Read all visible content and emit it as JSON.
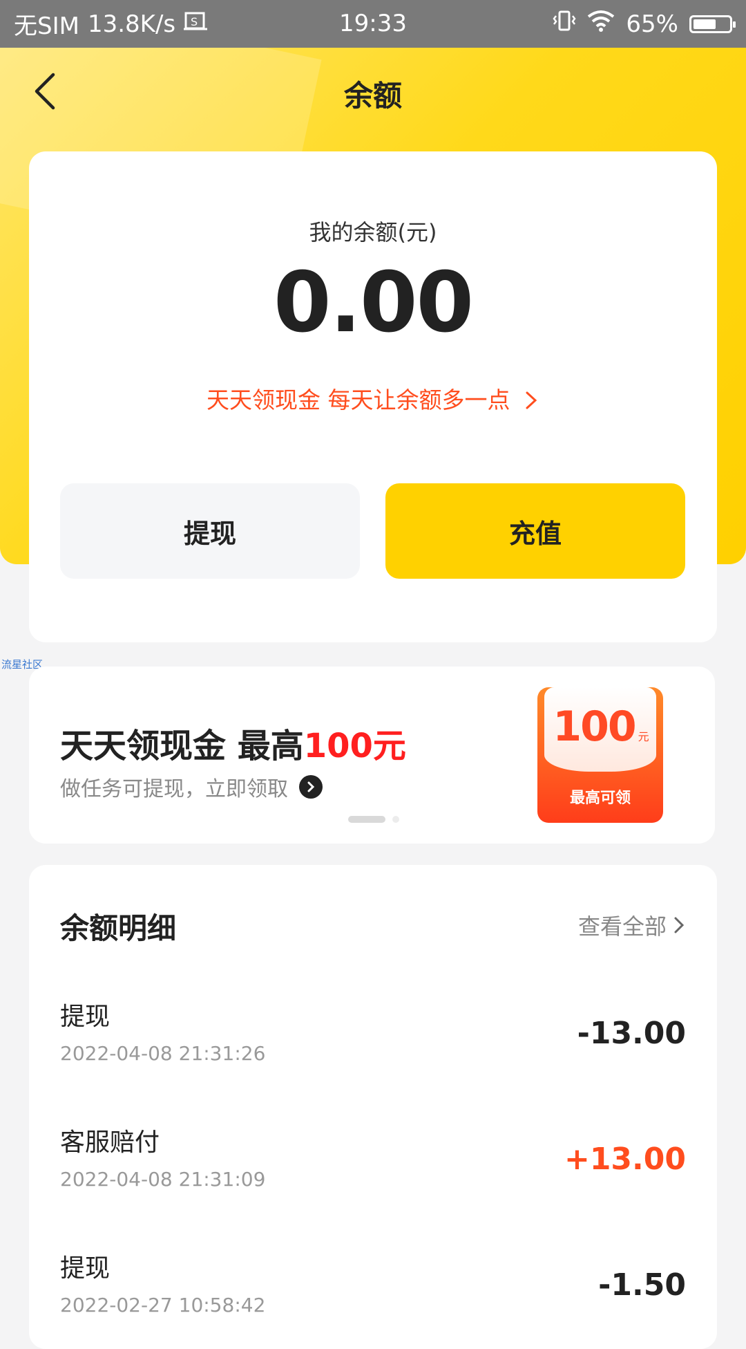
{
  "status_bar": {
    "sim": "无SIM",
    "speed": "13.8K/s",
    "time": "19:33",
    "battery": "65%",
    "battery_level": 0.65
  },
  "header": {
    "title": "余额"
  },
  "balance": {
    "label": "我的余额(元)",
    "value": "0.00",
    "promo_text": "天天领现金 每天让余额多一点",
    "withdraw_label": "提现",
    "recharge_label": "充值"
  },
  "watermark": "流星社区",
  "banner": {
    "title_prefix": "天天领现金 最高",
    "title_highlight": "100元",
    "subtitle": "做任务可提现，立即领取",
    "packet_amount": "100",
    "packet_unit": "元",
    "packet_label": "最高可领"
  },
  "details": {
    "title": "余额明细",
    "view_all": "查看全部",
    "transactions": [
      {
        "name": "提现",
        "time": "2022-04-08 21:31:26",
        "amount": "-13.00"
      },
      {
        "name": "客服赔付",
        "time": "2022-04-08 21:31:09",
        "amount": "+13.00"
      },
      {
        "name": "提现",
        "time": "2022-02-27 10:58:42",
        "amount": "-1.50"
      }
    ]
  },
  "colors": {
    "accent_yellow": "#ffd100",
    "promo_orange": "#ff4d1e",
    "highlight_red": "#ff1f1f"
  }
}
